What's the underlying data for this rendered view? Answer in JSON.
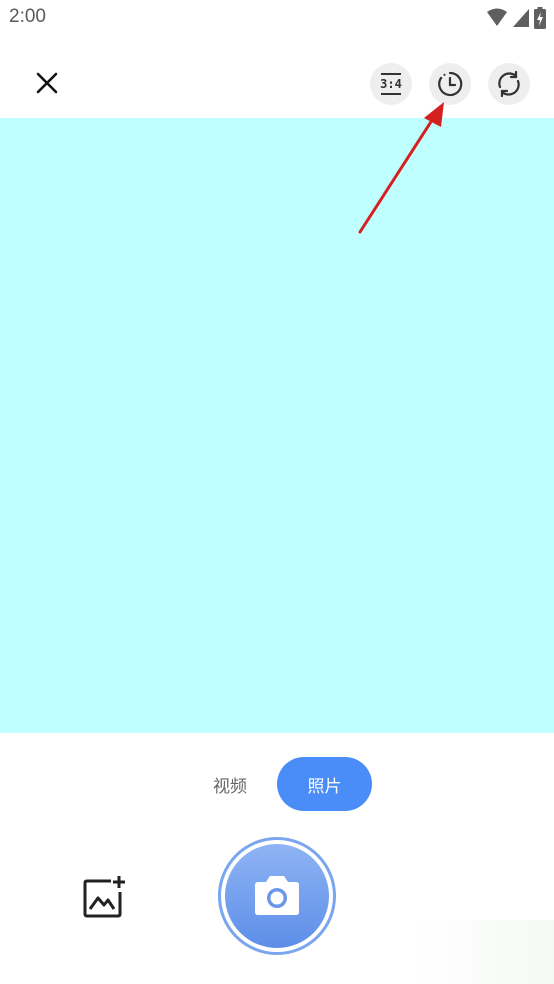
{
  "status_bar": {
    "time": "2:00",
    "icons": [
      "wifi-icon",
      "signal-icon",
      "battery-charging-icon"
    ]
  },
  "toolbar": {
    "close_icon": "close-icon",
    "ratio_label": "3:4",
    "timer_icon": "timer-icon",
    "flip_icon": "flip-camera-icon"
  },
  "viewfinder": {
    "color": "#c0ffff"
  },
  "modes": {
    "video_label": "视频",
    "photo_label": "照片",
    "active": "照片",
    "active_color": "#4b8df8"
  },
  "controls": {
    "gallery_icon": "add-image-icon",
    "shutter_icon": "camera-icon"
  },
  "annotation": {
    "arrow_color": "#d62020",
    "target": "timer-button"
  }
}
